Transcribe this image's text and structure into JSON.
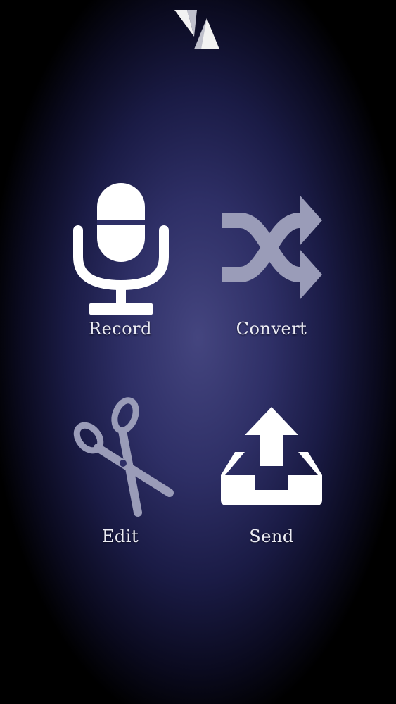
{
  "app": {
    "logo_icon": "app-logo-icon"
  },
  "menu": {
    "record": {
      "label": "Record",
      "icon": "microphone-icon"
    },
    "convert": {
      "label": "Convert",
      "icon": "shuffle-icon"
    },
    "edit": {
      "label": "Edit",
      "icon": "scissors-icon"
    },
    "send": {
      "label": "Send",
      "icon": "upload-tray-icon"
    }
  },
  "colors": {
    "icon_active": "#ffffff",
    "icon_muted": "#9a9cb8",
    "label": "#ececf4",
    "background_center": "#44457f"
  }
}
